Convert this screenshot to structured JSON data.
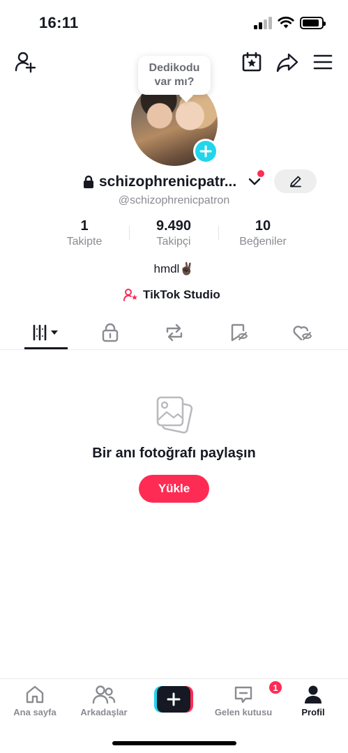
{
  "status_bar": {
    "time": "16:11"
  },
  "tooltip": {
    "line1": "Dedikodu",
    "line2": "var mı?"
  },
  "profile": {
    "username": "schizophrenicpatr...",
    "handle": "@schizophrenicpatron",
    "bio": "hmdl✌🏿",
    "studio_link": "TikTok Studio"
  },
  "stats": [
    {
      "value": "1",
      "label": "Takipte"
    },
    {
      "value": "9.490",
      "label": "Takipçi"
    },
    {
      "value": "10",
      "label": "Beğeniler"
    }
  ],
  "tabs": {
    "selected": "grid",
    "icons": [
      "grid-icon",
      "lock-icon",
      "repost-icon",
      "favorites-icon",
      "liked-icon"
    ]
  },
  "empty_state": {
    "title": "Bir anı fotoğrafı paylaşın",
    "button": "Yükle"
  },
  "bottom_nav": {
    "home": "Ana sayfa",
    "friends": "Arkadaşlar",
    "inbox": "Gelen kutusu",
    "inbox_badge": "1",
    "profile": "Profil"
  },
  "colors": {
    "accent": "#fe2c55",
    "cyan": "#20d5ec",
    "text": "#161823",
    "muted": "#8a8b91"
  }
}
